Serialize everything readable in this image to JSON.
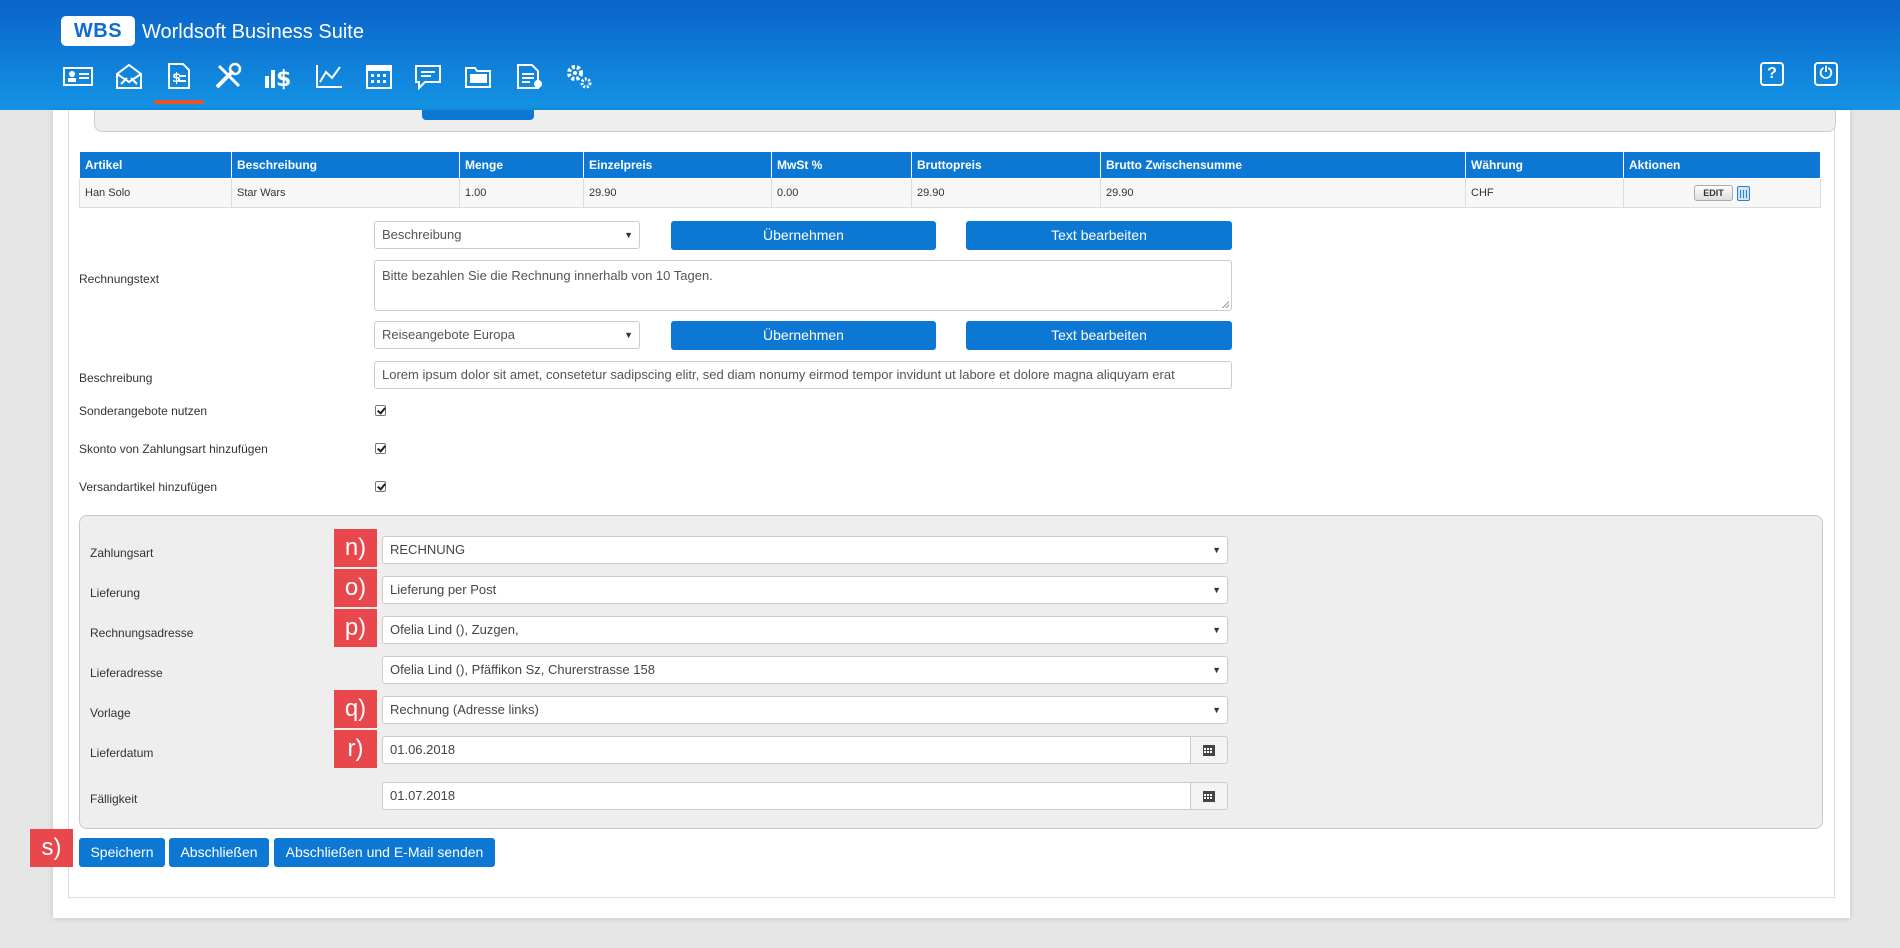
{
  "header": {
    "logo": "WBS",
    "title": "Worldsoft Business Suite",
    "nav_icons": [
      "contacts-icon",
      "mail-icon",
      "invoice-icon",
      "tools-icon",
      "finance-icon",
      "chart-icon",
      "calendar-icon",
      "messages-icon",
      "folder-icon",
      "documents-icon",
      "settings-icon"
    ],
    "help_label": "?",
    "power_label": "⏻"
  },
  "table": {
    "headers": [
      "Artikel",
      "Beschreibung",
      "Menge",
      "Einzelpreis",
      "MwSt %",
      "Bruttopreis",
      "Brutto Zwischensumme",
      "Währung",
      "Aktionen"
    ],
    "rows": [
      {
        "artikel": "Han Solo",
        "beschreibung": "Star Wars",
        "menge": "1.00",
        "einzelpreis": "29.90",
        "mwst": "0.00",
        "bruttopreis": "29.90",
        "zwischensumme": "29.90",
        "waehrung": "CHF",
        "edit": "EDIT"
      }
    ]
  },
  "text_section": {
    "select1": "Beschreibung",
    "apply1": "Übernehmen",
    "edit1": "Text bearbeiten",
    "rechnungstext_label": "Rechnungstext",
    "rechnungstext_value": "Bitte bezahlen Sie die Rechnung innerhalb von 10 Tagen.",
    "select2": "Reiseangebote Europa",
    "apply2": "Übernehmen",
    "edit2": "Text bearbeiten",
    "beschreibung_label": "Beschreibung",
    "beschreibung_value": "Lorem ipsum dolor sit amet, consetetur sadipscing elitr, sed diam nonumy eirmod tempor invidunt ut labore et dolore magna aliquyam erat",
    "sonderangebote_label": "Sonderangebote nutzen",
    "skonto_label": "Skonto von Zahlungsart hinzufügen",
    "versand_label": "Versandartikel hinzufügen"
  },
  "settings": {
    "zahlungsart_label": "Zahlungsart",
    "zahlungsart_value": "RECHNUNG",
    "lieferung_label": "Lieferung",
    "lieferung_value": "Lieferung per Post",
    "rechnungsadresse_label": "Rechnungsadresse",
    "rechnungsadresse_value": "Ofelia Lind (), Zuzgen,",
    "lieferadresse_label": "Lieferadresse",
    "lieferadresse_value": "Ofelia Lind (), Pfäffikon Sz, Churerstrasse 158",
    "vorlage_label": "Vorlage",
    "vorlage_value": "Rechnung (Adresse links)",
    "lieferdatum_label": "Lieferdatum",
    "lieferdatum_value": "01.06.2018",
    "faelligkeit_label": "Fälligkeit",
    "faelligkeit_value": "01.07.2018"
  },
  "markers": {
    "n": "n)",
    "o": "o)",
    "p": "p)",
    "q": "q)",
    "r": "r)",
    "s": "s)"
  },
  "actions": {
    "save": "Speichern",
    "close": "Abschließen",
    "close_send": "Abschließen und E-Mail senden"
  },
  "colors": {
    "header_top": "#0a63c9",
    "header_bottom": "#1494e4",
    "primary": "#0d78d4",
    "active_tab": "#e8532c",
    "marker": "#e8474c"
  }
}
